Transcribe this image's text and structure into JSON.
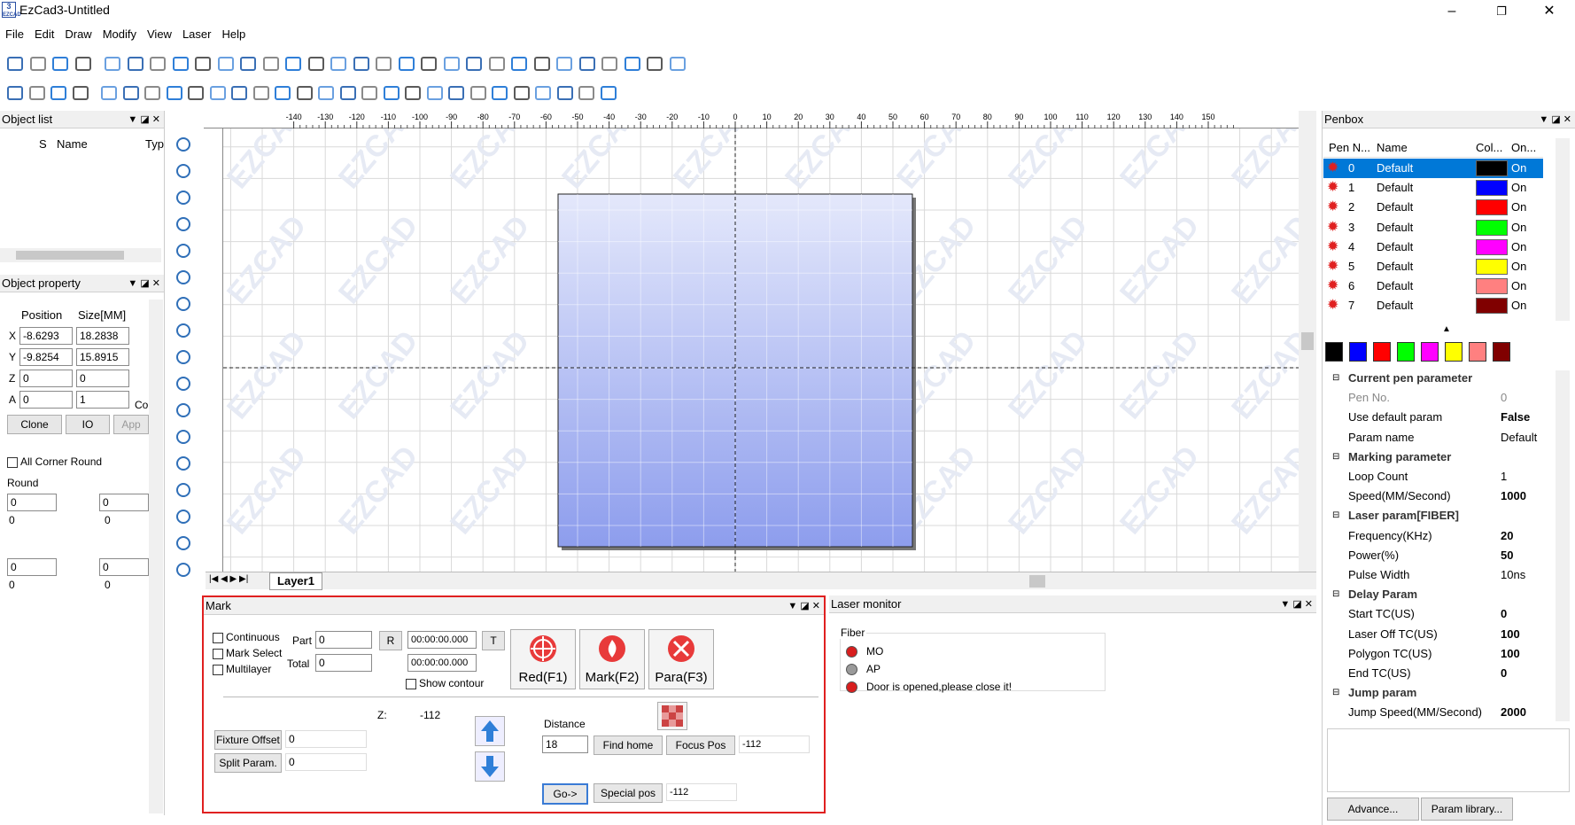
{
  "window": {
    "title": "EzCad3-Untitled",
    "logo_text": "3 EZCAD"
  },
  "menu": [
    "File",
    "Edit",
    "Draw",
    "Modify",
    "View",
    "Laser",
    "Help"
  ],
  "object_list": {
    "title": "Object list",
    "columns": [
      "S",
      "Name",
      "Typ"
    ]
  },
  "object_property": {
    "title": "Object property",
    "col_position": "Position",
    "col_size": "Size[MM]",
    "x_label": "X",
    "y_label": "Y",
    "z_label": "Z",
    "a_label": "A",
    "x_pos": "-8.6293",
    "x_size": "18.2838",
    "y_pos": "-9.8254",
    "y_size": "15.8915",
    "z_pos": "0",
    "z_size": "0",
    "a_pos": "0",
    "a_count": "1",
    "clone": "Clone",
    "io": "IO",
    "app": "App",
    "co": "Co",
    "all_corner_round": "All Corner Round",
    "round_label": "Round",
    "round1": "0",
    "round2": "0",
    "round3": "0",
    "round4": "0",
    "round1_val": "0",
    "round2_val": "0",
    "round3_val": "0",
    "round4_val": "0"
  },
  "canvas": {
    "ruler_ticks": [
      "-140",
      "-130",
      "-120",
      "-110",
      "-100",
      "-90",
      "-80",
      "-70",
      "-60",
      "-50",
      "-40",
      "-30",
      "-20",
      "-10",
      "0",
      "10",
      "20",
      "30",
      "40",
      "50",
      "60",
      "70",
      "80",
      "90",
      "100",
      "110",
      "120",
      "130",
      "140",
      "150"
    ],
    "watermark": "EZCAD",
    "layer_tab": "Layer1"
  },
  "mark": {
    "title": "Mark",
    "continuous": "Continuous",
    "mark_select": "Mark Select",
    "multilayer": "Multilayer",
    "part_label": "Part",
    "part_value": "0",
    "total_label": "Total",
    "total_value": "0",
    "r_btn": "R",
    "t_btn": "T",
    "time1": "00:00:00.000",
    "time2": "00:00:00.000",
    "show_contour": "Show contour",
    "red_btn": "Red(F1)",
    "mark_btn": "Mark(F2)",
    "para_btn": "Para(F3)",
    "z_label": "Z:",
    "z_value": "-112",
    "fixture_offset": "Fixture Offset",
    "fixture_value": "0",
    "split_param": "Split Param.",
    "split_value": "0",
    "distance_label": "Distance",
    "distance_value": "18",
    "find_home": "Find home",
    "focus_pos": "Focus Pos",
    "focus_value": "-112",
    "go_btn": "Go->",
    "special_pos": "Special pos",
    "special_value": "-112"
  },
  "laser_monitor": {
    "title": "Laser monitor",
    "group": "Fiber",
    "items": [
      {
        "label": "MO",
        "color": "#d81e1e"
      },
      {
        "label": "AP",
        "color": "#9a9a9a"
      },
      {
        "label": "Door is opened,please close it!",
        "color": "#d81e1e"
      }
    ]
  },
  "penbox": {
    "title": "Penbox",
    "columns": [
      "Pen N...",
      "Name",
      "Col...",
      "On..."
    ],
    "pens": [
      {
        "no": "0",
        "name": "Default",
        "color": "#000000",
        "on": "On"
      },
      {
        "no": "1",
        "name": "Default",
        "color": "#0000ff",
        "on": "On"
      },
      {
        "no": "2",
        "name": "Default",
        "color": "#ff0000",
        "on": "On"
      },
      {
        "no": "3",
        "name": "Default",
        "color": "#00ff00",
        "on": "On"
      },
      {
        "no": "4",
        "name": "Default",
        "color": "#ff00ff",
        "on": "On"
      },
      {
        "no": "5",
        "name": "Default",
        "color": "#ffff00",
        "on": "On"
      },
      {
        "no": "6",
        "name": "Default",
        "color": "#ff8080",
        "on": "On"
      },
      {
        "no": "7",
        "name": "Default",
        "color": "#800000",
        "on": "On"
      }
    ],
    "swatches": [
      "#000000",
      "#0000ff",
      "#ff0000",
      "#00ff00",
      "#ff00ff",
      "#ffff00",
      "#ff8080",
      "#800000"
    ]
  },
  "params": {
    "rows": [
      {
        "group": true,
        "k": "Current pen parameter"
      },
      {
        "k": "Pen No.",
        "v": "0",
        "gray": true
      },
      {
        "k": "Use default param",
        "v": "False",
        "bold": true
      },
      {
        "k": "Param name",
        "v": "Default"
      },
      {
        "group": true,
        "k": "Marking parameter"
      },
      {
        "k": "Loop Count",
        "v": "1"
      },
      {
        "k": "Speed(MM/Second)",
        "v": "1000",
        "bold": true
      },
      {
        "group": true,
        "k": "Laser param[FIBER]"
      },
      {
        "k": "Frequency(KHz)",
        "v": "20",
        "bold": true
      },
      {
        "k": "Power(%)",
        "v": "50",
        "bold": true
      },
      {
        "k": "Pulse Width",
        "v": "10ns"
      },
      {
        "group": true,
        "k": "Delay Param"
      },
      {
        "k": "Start TC(US)",
        "v": "0",
        "bold": true
      },
      {
        "k": "Laser Off TC(US)",
        "v": "100",
        "bold": true
      },
      {
        "k": "Polygon TC(US)",
        "v": "100",
        "bold": true
      },
      {
        "k": "End TC(US)",
        "v": "0",
        "bold": true
      },
      {
        "group": true,
        "k": "Jump param"
      },
      {
        "k": "Jump Speed(MM/Second)",
        "v": "2000",
        "bold": true
      }
    ],
    "advance": "Advance...",
    "param_library": "Param library..."
  }
}
